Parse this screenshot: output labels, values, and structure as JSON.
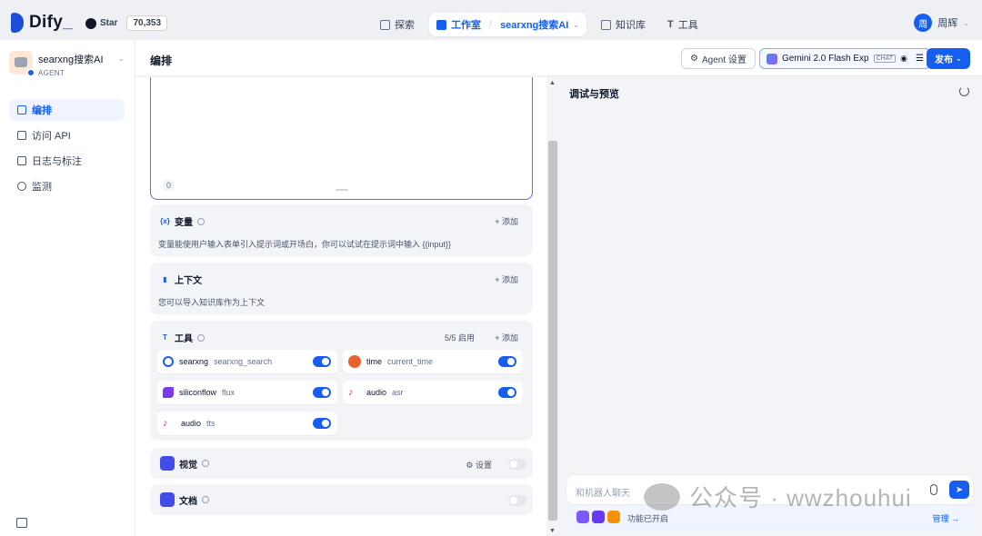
{
  "brand": {
    "name": "Dify",
    "suffix": "_"
  },
  "github": {
    "label": "Star",
    "count": "70,353"
  },
  "nav": {
    "explore": "探索",
    "studio": "工作室",
    "current_app": "searxng搜索AI",
    "knowledge": "知识库",
    "tools": "工具"
  },
  "user": {
    "avatar_letter": "周",
    "name": "周辉"
  },
  "app": {
    "name": "searxng搜索AI",
    "type": "AGENT"
  },
  "sidebar": {
    "items": [
      {
        "label": "编排",
        "icon": "orchestrate-icon"
      },
      {
        "label": "访问 API",
        "icon": "api-icon"
      },
      {
        "label": "日志与标注",
        "icon": "logs-icon"
      },
      {
        "label": "监测",
        "icon": "monitor-icon"
      }
    ]
  },
  "header": {
    "title": "编排",
    "agent_settings": "Agent 设置",
    "model": "Gemini 2.0 Flash Exp",
    "model_tag": "CHAT",
    "publish": "发布"
  },
  "prompt": {
    "char_count": "0"
  },
  "variables": {
    "title": "变量",
    "add": "+ 添加",
    "desc": "变量能使用户输入表单引入提示词或开场白，你可以试试在提示词中输入 {{input}}"
  },
  "context": {
    "title": "上下文",
    "add": "+ 添加",
    "desc": "您可以导入知识库作为上下文"
  },
  "tools": {
    "title": "工具",
    "enabled_count": "5/5 启用",
    "add": "+ 添加",
    "items": [
      {
        "provider": "searxng",
        "name": "searxng_search",
        "enabled": true
      },
      {
        "provider": "time",
        "name": "current_time",
        "enabled": true
      },
      {
        "provider": "siliconflow",
        "name": "flux",
        "enabled": true
      },
      {
        "provider": "audio",
        "name": "asr",
        "enabled": true
      },
      {
        "provider": "audio",
        "name": "tts",
        "enabled": true
      }
    ]
  },
  "vision": {
    "title": "视觉",
    "settings": "设置",
    "enabled": false
  },
  "document": {
    "title": "文档",
    "enabled": false
  },
  "debug": {
    "title": "调试与预览",
    "input_placeholder": "和机器人聊天",
    "features_enabled": "功能已开启",
    "manage": "管理 →"
  },
  "watermark": {
    "text": "公众号 · wwzhouhui"
  },
  "colors": {
    "accent": "#155eef",
    "prompt_border": "#6366f1",
    "panel_bg": "#f2f4f7"
  }
}
